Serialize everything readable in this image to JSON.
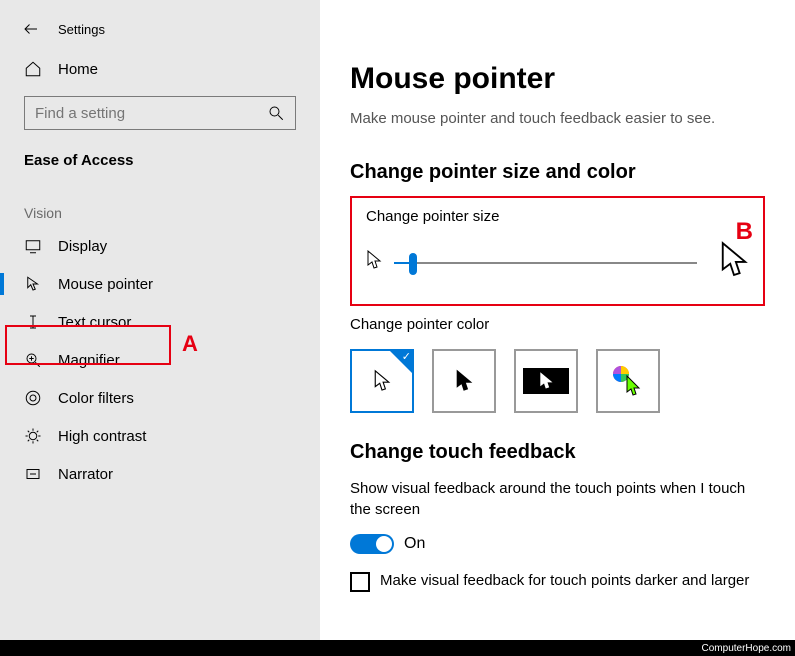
{
  "window": {
    "title": "Settings"
  },
  "sidebar": {
    "home": "Home",
    "search_placeholder": "Find a setting",
    "category": "Ease of Access",
    "group": "Vision",
    "items": [
      {
        "label": "Display"
      },
      {
        "label": "Mouse pointer"
      },
      {
        "label": "Text cursor"
      },
      {
        "label": "Magnifier"
      },
      {
        "label": "Color filters"
      },
      {
        "label": "High contrast"
      },
      {
        "label": "Narrator"
      }
    ]
  },
  "main": {
    "title": "Mouse pointer",
    "subtitle": "Make mouse pointer and touch feedback easier to see.",
    "section_size_color": "Change pointer size and color",
    "pointer_size_label": "Change pointer size",
    "pointer_color_label": "Change pointer color",
    "touch_heading": "Change touch feedback",
    "touch_text": "Show visual feedback around the touch points when I touch the screen",
    "toggle_label": "On",
    "checkbox_label": "Make visual feedback for touch points darker and larger"
  },
  "annotations": {
    "a": "A",
    "b": "B"
  },
  "footer": "ComputerHope.com"
}
